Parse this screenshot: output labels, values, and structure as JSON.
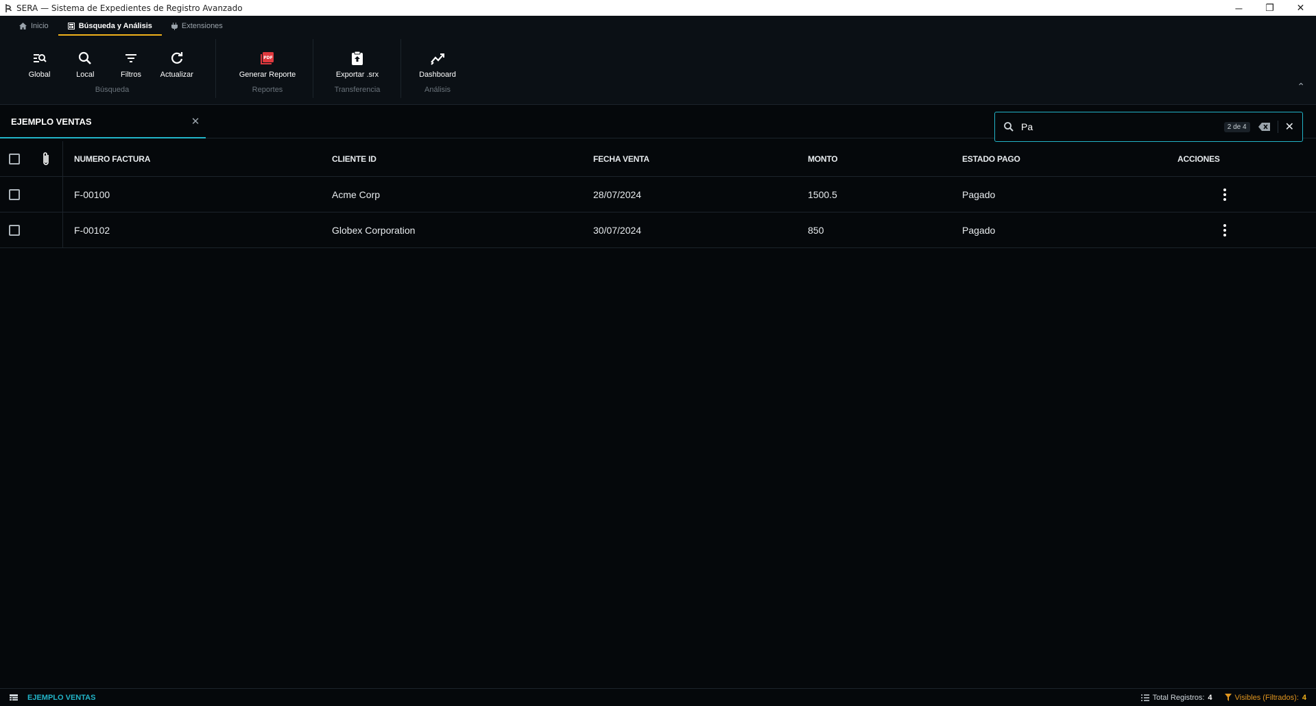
{
  "window": {
    "title": "SERA — Sistema de Expedientes de Registro Avanzado",
    "minimize": "─",
    "restore": "❐",
    "close": "✕"
  },
  "ribbon_tabs": [
    {
      "label": "Inicio",
      "icon": "home-icon",
      "active": false
    },
    {
      "label": "Búsqueda y Análisis",
      "icon": "table-icon",
      "active": true
    },
    {
      "label": "Extensiones",
      "icon": "puzzle-icon",
      "active": false
    }
  ],
  "ribbon": {
    "groups": [
      {
        "label": "Búsqueda",
        "buttons": [
          {
            "label": "Global",
            "icon": "global-search-icon"
          },
          {
            "label": "Local",
            "icon": "search-icon"
          },
          {
            "label": "Filtros",
            "icon": "filter-icon"
          },
          {
            "label": "Actualizar",
            "icon": "refresh-icon"
          }
        ]
      },
      {
        "label": "Reportes",
        "buttons": [
          {
            "label": "Generar Reporte",
            "icon": "pdf-icon"
          }
        ]
      },
      {
        "label": "Transferencia",
        "buttons": [
          {
            "label": "Exportar .srx",
            "icon": "export-clipboard-icon"
          }
        ]
      },
      {
        "label": "Análisis",
        "buttons": [
          {
            "label": "Dashboard",
            "icon": "trend-chart-icon"
          }
        ]
      }
    ],
    "collapse": "⌃"
  },
  "doc_tab": {
    "label": "EJEMPLO VENTAS",
    "close": "✕"
  },
  "search": {
    "value": "Pa",
    "count": "2 de 4",
    "close": "✕"
  },
  "table": {
    "columns": [
      "NUMERO FACTURA",
      "CLIENTE ID",
      "FECHA VENTA",
      "MONTO",
      "ESTADO PAGO",
      "ACCIONES"
    ],
    "rows": [
      [
        "F-00100",
        "Acme Corp",
        "28/07/2024",
        "1500.5",
        "Pagado"
      ],
      [
        "F-00102",
        "Globex Corporation",
        "30/07/2024",
        "850",
        "Pagado"
      ]
    ]
  },
  "statusbar": {
    "table_name": "EJEMPLO VENTAS",
    "total_label": "Total Registros:",
    "total_value": "4",
    "visible_label": "Visibles (Filtrados):",
    "visible_value": "4"
  },
  "colors": {
    "accent": "#22b5c9",
    "active_tab_underline": "#f2b21b",
    "pdf_red": "#e0393e",
    "filtered_orange": "#e0951f",
    "background": "#05080b"
  }
}
